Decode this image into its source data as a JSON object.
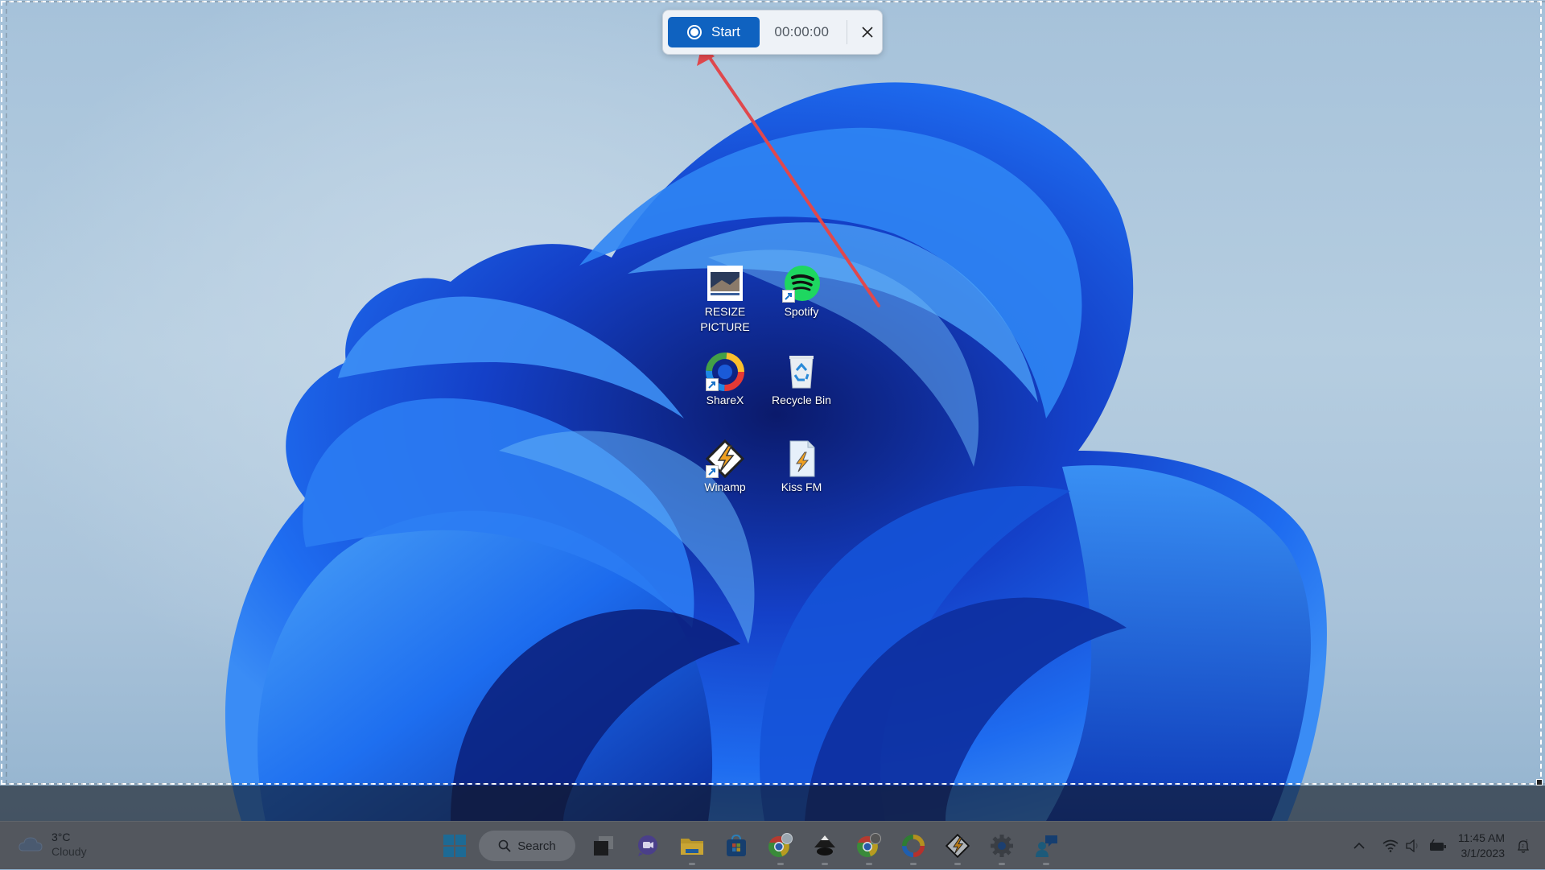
{
  "recorder": {
    "start_label": "Start",
    "timer": "00:00:00",
    "colors": {
      "start_button": "#0f62c0",
      "annotation_arrow": "#e0484d"
    }
  },
  "desktop": {
    "icons": [
      {
        "label_line1": "RESIZE",
        "label_line2": "PICTURE",
        "icon": "image-file-icon",
        "shortcut": false
      },
      {
        "label_line1": "Spotify",
        "label_line2": "",
        "icon": "spotify-icon",
        "shortcut": true
      },
      {
        "label_line1": "ShareX",
        "label_line2": "",
        "icon": "sharex-icon",
        "shortcut": true
      },
      {
        "label_line1": "Recycle Bin",
        "label_line2": "",
        "icon": "recycle-bin-icon",
        "shortcut": false
      },
      {
        "label_line1": "Winamp",
        "label_line2": "",
        "icon": "winamp-icon",
        "shortcut": true
      },
      {
        "label_line1": "Kiss FM",
        "label_line2": "",
        "icon": "winamp-playlist-file-icon",
        "shortcut": false
      }
    ]
  },
  "taskbar": {
    "weather": {
      "temp": "3°C",
      "condition": "Cloudy",
      "icon": "cloud-icon"
    },
    "search_label": "Search",
    "apps": [
      {
        "name": "Start",
        "icon": "windows-start-icon"
      },
      {
        "name": "Task View",
        "icon": "task-view-icon"
      },
      {
        "name": "Chat",
        "icon": "teams-chat-icon"
      },
      {
        "name": "File Explorer",
        "icon": "file-explorer-icon",
        "running": true
      },
      {
        "name": "Microsoft Store",
        "icon": "microsoft-store-icon"
      },
      {
        "name": "Chrome",
        "icon": "chrome-icon",
        "running": true
      },
      {
        "name": "Inkscape",
        "icon": "inkscape-icon",
        "running": true
      },
      {
        "name": "Chrome",
        "icon": "chrome-icon",
        "running": true
      },
      {
        "name": "ShareX",
        "icon": "sharex-icon",
        "running": true
      },
      {
        "name": "Winamp",
        "icon": "winamp-icon",
        "running": true
      },
      {
        "name": "Settings",
        "icon": "settings-gear-icon",
        "running": true
      },
      {
        "name": "Quick Assist",
        "icon": "quick-assist-icon",
        "running": true
      }
    ],
    "tray": {
      "time": "11:45 AM",
      "date": "3/1/2023"
    }
  }
}
